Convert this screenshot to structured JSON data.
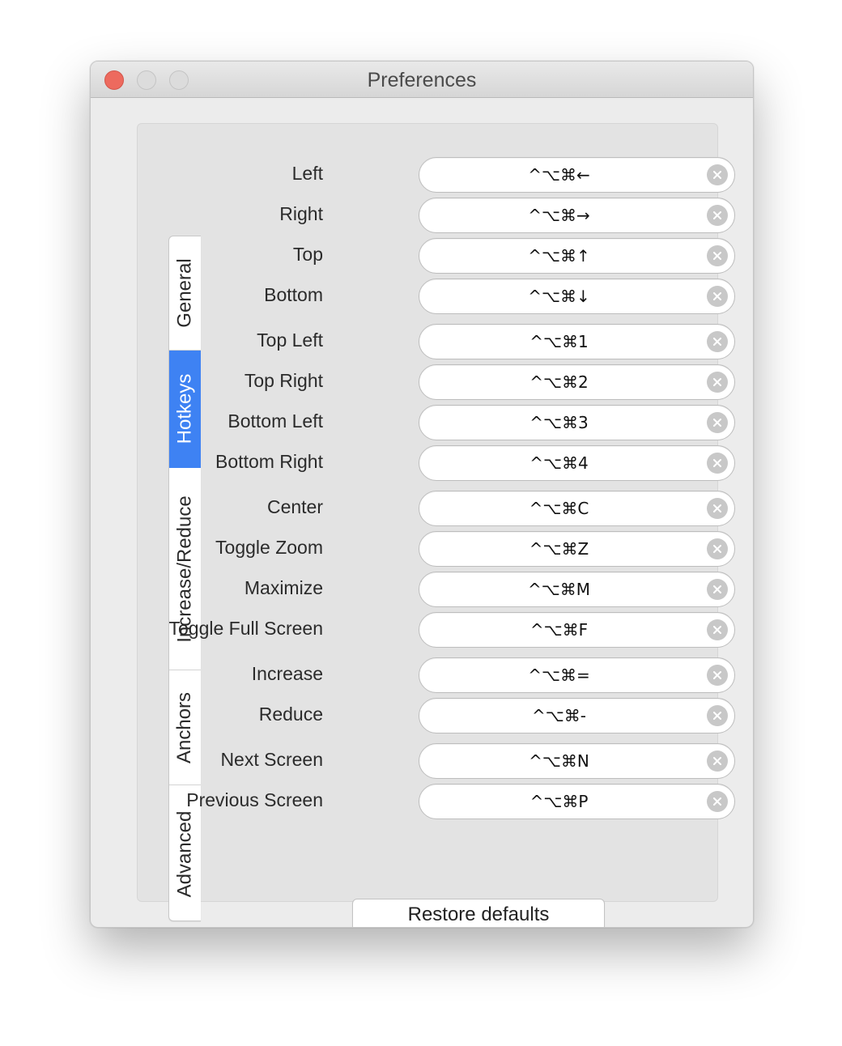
{
  "window": {
    "title": "Preferences"
  },
  "tabs": [
    {
      "label": "General",
      "active": false
    },
    {
      "label": "Hotkeys",
      "active": true
    },
    {
      "label": "Increase/Reduce",
      "active": false
    },
    {
      "label": "Anchors",
      "active": false
    },
    {
      "label": "Advanced",
      "active": false
    }
  ],
  "hotkeys": [
    {
      "label": "Left",
      "shortcut": "^⌥⌘←"
    },
    {
      "label": "Right",
      "shortcut": "^⌥⌘→"
    },
    {
      "label": "Top",
      "shortcut": "^⌥⌘↑"
    },
    {
      "label": "Bottom",
      "shortcut": "^⌥⌘↓"
    },
    {
      "label": "Top Left",
      "shortcut": "^⌥⌘1"
    },
    {
      "label": "Top Right",
      "shortcut": "^⌥⌘2"
    },
    {
      "label": "Bottom Left",
      "shortcut": "^⌥⌘3"
    },
    {
      "label": "Bottom Right",
      "shortcut": "^⌥⌘4"
    },
    {
      "label": "Center",
      "shortcut": "^⌥⌘C"
    },
    {
      "label": "Toggle Zoom",
      "shortcut": "^⌥⌘Z"
    },
    {
      "label": "Maximize",
      "shortcut": "^⌥⌘M"
    },
    {
      "label": "Toggle Full Screen",
      "shortcut": "^⌥⌘F"
    },
    {
      "label": "Increase",
      "shortcut": "^⌥⌘="
    },
    {
      "label": "Reduce",
      "shortcut": "^⌥⌘-"
    },
    {
      "label": "Next Screen",
      "shortcut": "^⌥⌘N"
    },
    {
      "label": "Previous Screen",
      "shortcut": "^⌥⌘P"
    }
  ],
  "restore_label": "Restore defaults",
  "icons": {
    "clear": "clear-circle-x-icon"
  },
  "colors": {
    "accent": "#3e82f3",
    "close": "#ed6a5e"
  }
}
